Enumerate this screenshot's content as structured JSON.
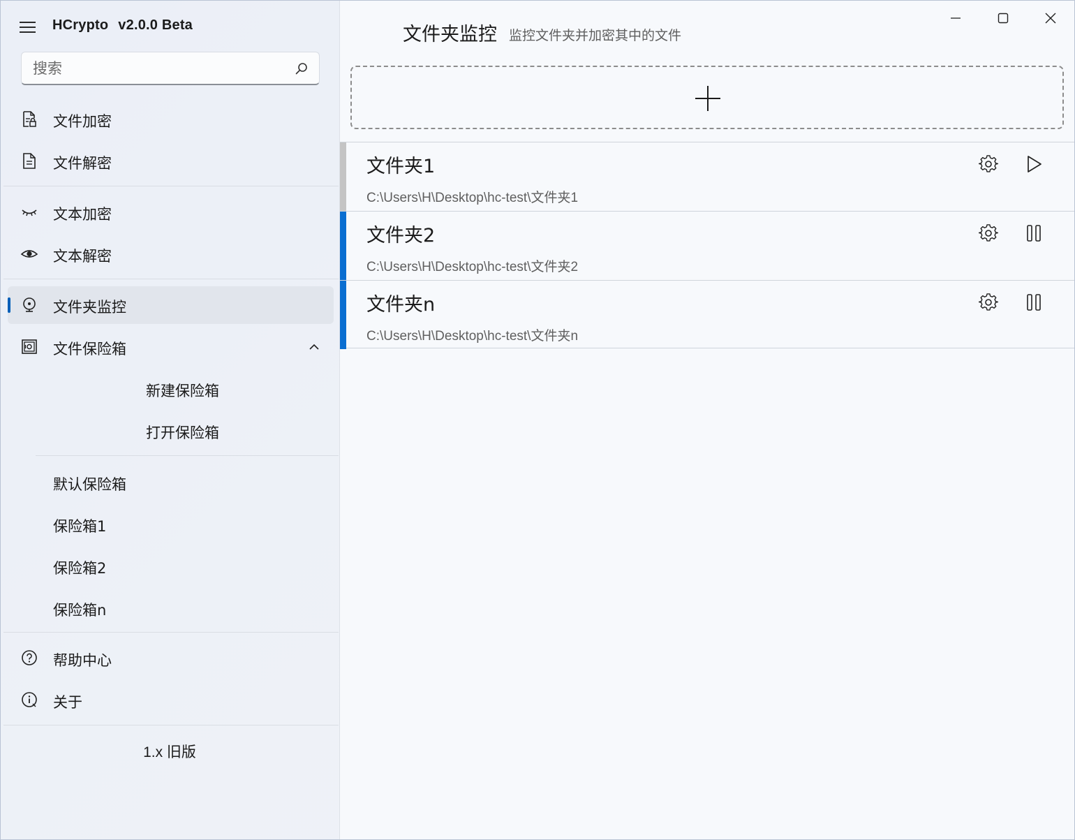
{
  "app": {
    "name": "HCrypto",
    "version": "v2.0.0 Beta"
  },
  "search": {
    "placeholder": "搜索"
  },
  "nav": {
    "file_encrypt": "文件加密",
    "file_decrypt": "文件解密",
    "text_encrypt": "文本加密",
    "text_decrypt": "文本解密",
    "folder_monitor": "文件夹监控",
    "vault": "文件保险箱",
    "new_vault": "新建保险箱",
    "open_vault": "打开保险箱",
    "vaults": [
      "默认保险箱",
      "保险箱1",
      "保险箱2",
      "保险箱n"
    ],
    "help": "帮助中心",
    "about": "关于",
    "legacy": "1.x 旧版"
  },
  "page": {
    "title": "文件夹监控",
    "subtitle": "监控文件夹并加密其中的文件"
  },
  "folders": [
    {
      "name": "文件夹1",
      "path": "C:\\Users\\H\\Desktop\\hc-test\\文件夹1",
      "state": "stopped",
      "action_icon": "play-icon"
    },
    {
      "name": "文件夹2",
      "path": "C:\\Users\\H\\Desktop\\hc-test\\文件夹2",
      "state": "running",
      "action_icon": "pause-icon"
    },
    {
      "name": "文件夹n",
      "path": "C:\\Users\\H\\Desktop\\hc-test\\文件夹n",
      "state": "running",
      "action_icon": "pause-icon"
    }
  ],
  "colors": {
    "accent": "#005fb8",
    "running_bar": "#0a6ed1",
    "stopped_bar": "#c4c4c4"
  }
}
